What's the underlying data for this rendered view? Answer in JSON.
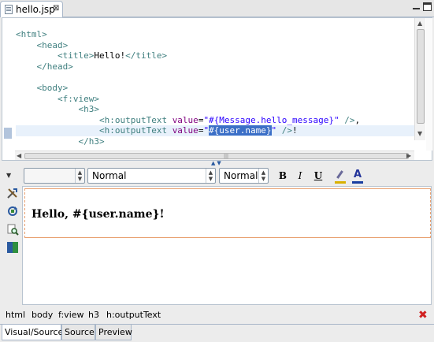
{
  "editor_tab": {
    "title": "hello.jsp",
    "close": "⊠"
  },
  "source": {
    "lines": [
      {
        "indent": 0,
        "parts": [
          {
            "c": "t",
            "v": "<html>"
          }
        ]
      },
      {
        "indent": 1,
        "parts": [
          {
            "c": "t",
            "v": "<head>"
          }
        ]
      },
      {
        "indent": 2,
        "parts": [
          {
            "c": "t",
            "v": "<title>"
          },
          {
            "c": "",
            "v": "Hello!"
          },
          {
            "c": "t",
            "v": "</title>"
          }
        ]
      },
      {
        "indent": 1,
        "parts": [
          {
            "c": "t",
            "v": "</head>"
          }
        ]
      },
      {
        "indent": 0,
        "parts": []
      },
      {
        "indent": 1,
        "parts": [
          {
            "c": "t",
            "v": "<body>"
          }
        ]
      },
      {
        "indent": 2,
        "parts": [
          {
            "c": "t",
            "v": "<f:view>"
          }
        ]
      },
      {
        "indent": 3,
        "parts": [
          {
            "c": "t",
            "v": "<h3>"
          }
        ]
      },
      {
        "indent": 4,
        "parts": [
          {
            "c": "t",
            "v": "<h:outputText "
          },
          {
            "c": "a",
            "v": "value"
          },
          {
            "c": "",
            "v": "="
          },
          {
            "c": "s",
            "v": "\"#{Message.hello_message}\""
          },
          {
            "c": "t",
            "v": " />"
          },
          {
            "c": "",
            "v": ","
          }
        ]
      },
      {
        "indent": 4,
        "hl": true,
        "parts": [
          {
            "c": "t",
            "v": "<h:outputText "
          },
          {
            "c": "a",
            "v": "value"
          },
          {
            "c": "",
            "v": "="
          },
          {
            "c": "s",
            "v": "\""
          },
          {
            "c": "sel",
            "v": "#{user.name}"
          },
          {
            "c": "s",
            "v": "\""
          },
          {
            "c": "t",
            "v": " />"
          },
          {
            "c": "",
            "v": "!"
          }
        ]
      },
      {
        "indent": 3,
        "parts": [
          {
            "c": "t",
            "v": "</h3>"
          }
        ]
      }
    ]
  },
  "toolbar": {
    "font_value": "",
    "format_value": "Normal",
    "size_value": "Normal",
    "bold": "B",
    "italic": "I",
    "underline": "U",
    "font_color_glyph": "A"
  },
  "visual": {
    "heading": "Hello, #{user.name}!"
  },
  "breadcrumb": [
    "html",
    "body",
    "f:view",
    "h3",
    "h:outputText"
  ],
  "breadcrumb_close": "✖",
  "bottom_tabs": [
    "Visual/Source",
    "Source",
    "Preview"
  ],
  "colors": {
    "tag": "#3f7f7f",
    "attr": "#7f007f",
    "string": "#2a00ff",
    "selection": "#3b6fc7"
  }
}
